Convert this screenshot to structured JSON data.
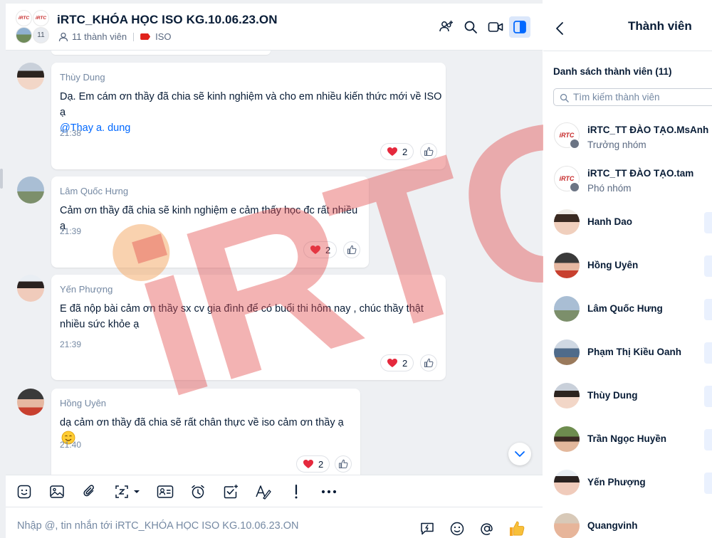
{
  "header": {
    "title": "iRTC_KHÓA HỌC ISO KG.10.06.23.ON",
    "member_count_label": "11 thành viên",
    "tag_label": "ISO",
    "avatar_logo": "iRTC",
    "avatar_extra_count": "11"
  },
  "messages": [
    {
      "sender": "Thùy Dung",
      "text": "Dạ. Em cám ơn thầy đã chia sẽ kinh nghiệm và cho em nhiều kiến thức mới về ISO ạ",
      "mention": "@Thay a. dung",
      "time": "21:38",
      "reaction_count": "2"
    },
    {
      "sender": "Lâm Quốc Hưng",
      "text": "Cảm ơn thầy đã chia sẽ kinh nghiệm e cảm thấy học đc rất nhiều ạ",
      "time": "21:39",
      "reaction_count": "2"
    },
    {
      "sender": "Yến Phượng",
      "text": "E đã nộp bài cảm ơn thầy sx cv gia đình để có buổi thi hôm nay , chúc thầy thật nhiều sức khỏe ạ",
      "time": "21:39",
      "reaction_count": "2"
    },
    {
      "sender": "Hồng Uyên",
      "text": "dạ cảm ơn thầy đã chia sẽ rất chân thực về iso cảm ơn thầy ạ",
      "time": "21:40",
      "reaction_count": "2"
    }
  ],
  "watermark": "iRTC",
  "composer": {
    "placeholder": "Nhập @, tin nhắn tới iRTC_KHÓA HỌC ISO KG.10.06.23.ON"
  },
  "members_panel": {
    "title": "Thành viên",
    "list_title": "Danh sách thành viên (11)",
    "search_placeholder": "Tìm kiếm thành viên",
    "members": [
      {
        "name": "iRTC_TT ĐÀO TẠO.MsAnh",
        "role": "Trưởng nhóm",
        "logo": "iRTC"
      },
      {
        "name": "iRTC_TT ĐÀO TẠO.tam",
        "role": "Phó nhóm",
        "logo": "iRTC"
      },
      {
        "name": "Hanh Dao"
      },
      {
        "name": "Hồng Uyên"
      },
      {
        "name": "Lâm Quốc Hưng"
      },
      {
        "name": "Phạm Thị Kiều Oanh"
      },
      {
        "name": "Thùy Dung"
      },
      {
        "name": "Trần Ngọc Huyền"
      },
      {
        "name": "Yến Phượng"
      },
      {
        "name": "Quangvinh"
      }
    ]
  },
  "colors": {
    "brand_blue": "#0068ff",
    "heart_red": "#e5293d",
    "tag_red": "#e0211b",
    "chat_bg": "#eef0f3"
  }
}
